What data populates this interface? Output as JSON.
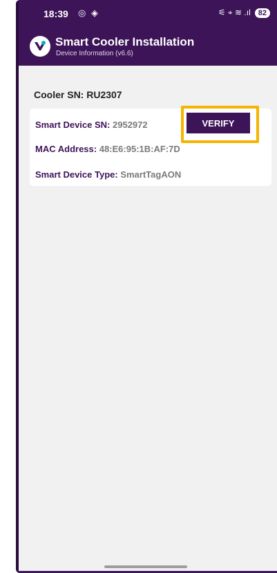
{
  "status_bar": {
    "time": "18:39",
    "left_icons": "◎ ◈",
    "right_icons": "⚟ ⌖ ≋ .ıl",
    "battery": "82"
  },
  "app_bar": {
    "title": "Smart Cooler Installation",
    "subtitle": "Device Information (v6.6)",
    "logo_icon": "brand-logo-icon"
  },
  "main": {
    "cooler_sn": "Cooler SN: RU2307",
    "card": {
      "smart_device_sn_label": "Smart Device SN:",
      "smart_device_sn_value": "2952972",
      "mac_label": "MAC Address:",
      "mac_value": "48:E6:95:1B:AF:7D",
      "type_label": "Smart Device Type:",
      "type_value": "SmartTagAON",
      "verify_label": "VERIFY"
    }
  },
  "colors": {
    "primary": "#3d1458",
    "highlight": "#f4b400",
    "background": "#f1f1f1"
  }
}
